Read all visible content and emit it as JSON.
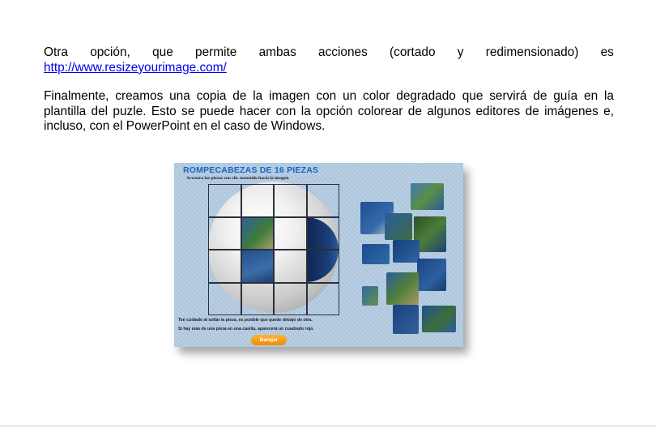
{
  "paragraph1": {
    "words": [
      "Otra",
      "opción,",
      "que",
      "permite",
      "ambas",
      "acciones",
      "(cortado",
      "y",
      "redimensionado)",
      "es"
    ],
    "link": "http://www.resizeyourimage.com/"
  },
  "paragraph2": {
    "lines": [
      "Finalmente, creamos una copia de la imagen con un color degradado que servirá de guía en la",
      "plantilla del puzle. Esto se puede hacer con la opción colorear de algunos editores de imágenes e,",
      "incluso, con el PowerPoint en el caso de Windows."
    ]
  },
  "puzzle": {
    "title": "ROMPECABEZAS DE 16 PIEZAS",
    "subtitle": "Arrastra las piezas con clic sostenido hacia la imagen",
    "note1": "Ten cuidado al soltar la pieza, es posible que quede debajo de otra.",
    "note2": "Si hay más de una pieza en una casilla, aparecerá un cuadrado rojo.",
    "shuffle_label": "Barajar"
  },
  "colors": {
    "link": "#0000ee",
    "puzzle_title": "#1565c6",
    "button": "#f08a00"
  }
}
